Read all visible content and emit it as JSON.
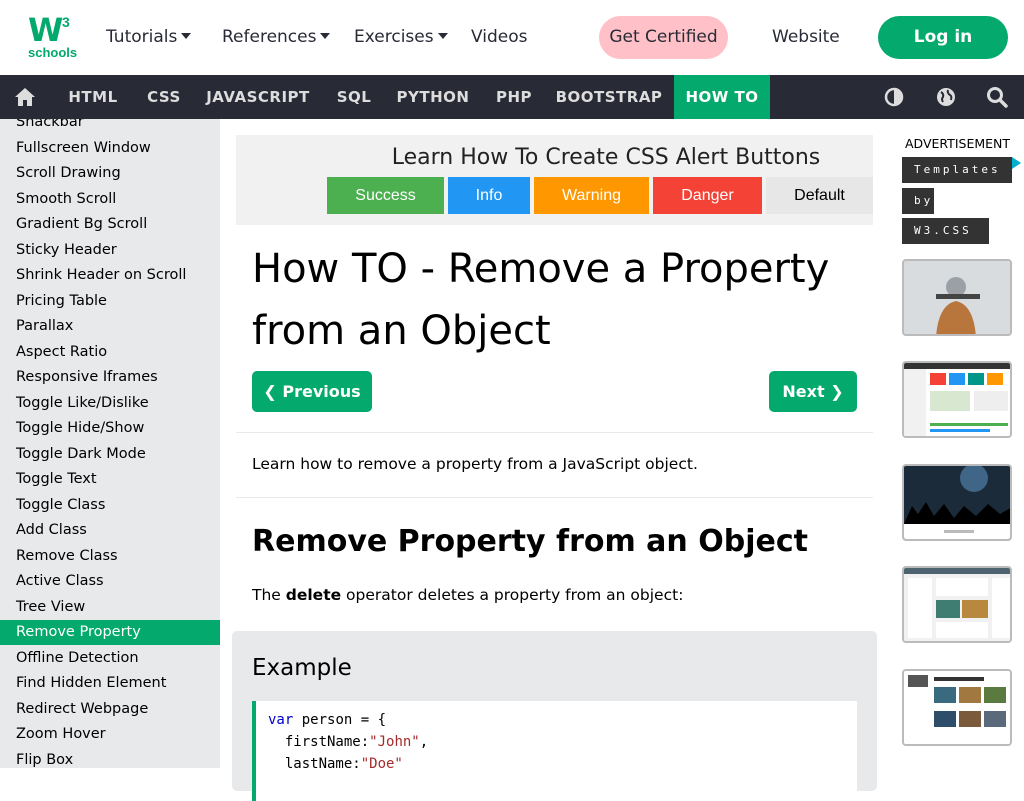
{
  "logo": {
    "main": "W",
    "sup": "3",
    "sub": "schools"
  },
  "topnav": {
    "items": [
      "Tutorials",
      "References",
      "Exercises",
      "Videos"
    ],
    "certified": "Get Certified",
    "website": "Website",
    "login": "Log in"
  },
  "darknav": {
    "items": [
      "HTML",
      "CSS",
      "JAVASCRIPT",
      "SQL",
      "PYTHON",
      "PHP",
      "BOOTSTRAP",
      "HOW TO"
    ],
    "active": "HOW TO",
    "icons": [
      "home-icon",
      "contrast-icon",
      "globe-icon",
      "search-icon"
    ]
  },
  "sidebar": {
    "items": [
      "Snackbar",
      "Fullscreen Window",
      "Scroll Drawing",
      "Smooth Scroll",
      "Gradient Bg Scroll",
      "Sticky Header",
      "Shrink Header on Scroll",
      "Pricing Table",
      "Parallax",
      "Aspect Ratio",
      "Responsive Iframes",
      "Toggle Like/Dislike",
      "Toggle Hide/Show",
      "Toggle Dark Mode",
      "Toggle Text",
      "Toggle Class",
      "Add Class",
      "Remove Class",
      "Active Class",
      "Tree View",
      "Remove Property",
      "Offline Detection",
      "Find Hidden Element",
      "Redirect Webpage",
      "Zoom Hover",
      "Flip Box"
    ],
    "active": "Remove Property"
  },
  "banner": {
    "title": "Learn How To Create CSS Alert Buttons",
    "buttons": [
      {
        "label": "Success",
        "color": "#4CAF50"
      },
      {
        "label": "Info",
        "color": "#2196F3"
      },
      {
        "label": "Warning",
        "color": "#ff9800"
      },
      {
        "label": "Danger",
        "color": "#f44336"
      },
      {
        "label": "Default",
        "color": "#e7e7e7"
      }
    ]
  },
  "main": {
    "title": "How TO - Remove a Property from an Object",
    "prev": "Previous",
    "next": "Next",
    "intro": "Learn how to remove a property from a JavaScript object.",
    "h2": "Remove Property from an Object",
    "desc_pre": "The ",
    "desc_bold": "delete",
    "desc_post": " operator deletes a property from an object:",
    "example_title": "Example",
    "code": {
      "line1_kw": "var",
      "line1_rest": " person = {",
      "line2_key": "  firstName:",
      "line2_val": "\"John\"",
      "line2_end": ",",
      "line3_key": "  lastName:",
      "line3_val": "\"Doe\""
    }
  },
  "ads": {
    "label": "ADVERTISEMENT",
    "tags": [
      "Templates",
      "by",
      "W3.CSS"
    ]
  },
  "colors": {
    "brand": "#04AA6D",
    "dark": "#282A35",
    "sidebar": "#E7E9EB",
    "cert": "#FFC0C7"
  }
}
